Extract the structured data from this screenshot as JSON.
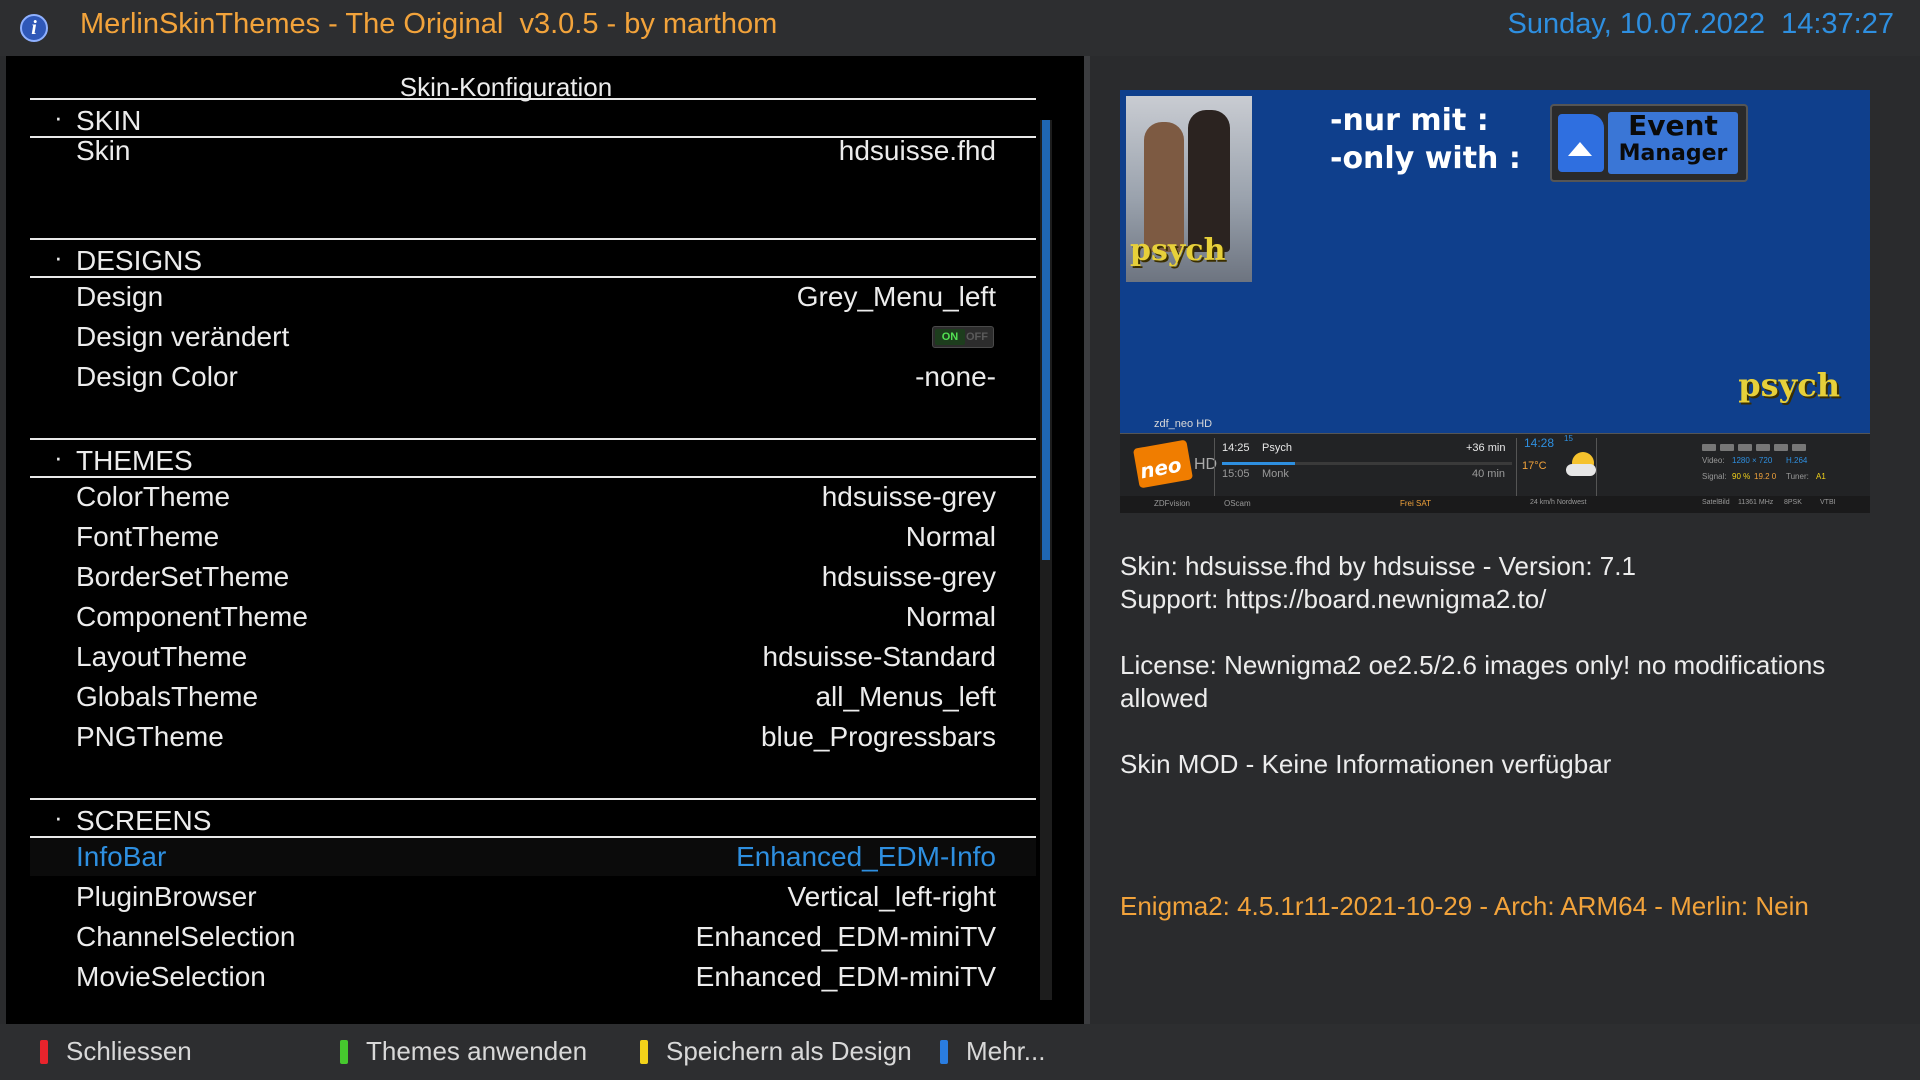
{
  "header": {
    "title": "MerlinSkinThemes - The Original  v3.0.5 - by marthom",
    "datetime": "Sunday, 10.07.2022  14:37:27"
  },
  "left_panel": {
    "title": "Skin-Konfiguration",
    "scroll_fraction_visible": 0.5,
    "sections": [
      {
        "name": "SKIN",
        "rows": [
          {
            "key": "Skin",
            "value": "hdsuisse.fhd"
          }
        ]
      },
      {
        "name": "DESIGNS",
        "rows": [
          {
            "key": "Design",
            "value": "Grey_Menu_left"
          },
          {
            "key": "Design verändert",
            "value": "",
            "toggle": {
              "on_label": "ON",
              "off_label": "OFF",
              "state": true
            }
          },
          {
            "key": "Design Color",
            "value": "-none-"
          }
        ]
      },
      {
        "name": "THEMES",
        "rows": [
          {
            "key": "ColorTheme",
            "value": "hdsuisse-grey"
          },
          {
            "key": "FontTheme",
            "value": "Normal"
          },
          {
            "key": "BorderSetTheme",
            "value": "hdsuisse-grey"
          },
          {
            "key": "ComponentTheme",
            "value": "Normal"
          },
          {
            "key": "LayoutTheme",
            "value": "hdsuisse-Standard"
          },
          {
            "key": "GlobalsTheme",
            "value": "all_Menus_left"
          },
          {
            "key": "PNGTheme",
            "value": "blue_Progressbars"
          }
        ]
      },
      {
        "name": "SCREENS",
        "rows": [
          {
            "key": "InfoBar",
            "value": "Enhanced_EDM-Info",
            "selected": true
          },
          {
            "key": "PluginBrowser",
            "value": "Vertical_left-right"
          },
          {
            "key": "ChannelSelection",
            "value": "Enhanced_EDM-miniTV"
          },
          {
            "key": "MovieSelection",
            "value": "Enhanced_EDM-miniTV"
          }
        ]
      }
    ]
  },
  "preview": {
    "poster_title": "psych",
    "notice": "-nur mit :\n-only with :",
    "badge_line1": "Event",
    "badge_line2": "Manager",
    "watermark": "psych",
    "channel_name": "zdf_neo HD",
    "infobar": {
      "logo_text": "neo",
      "logo_hd": "HD",
      "now_time": "14:25",
      "now_title": "Psych",
      "now_remaining": "+36 min",
      "next_time": "15:05",
      "next_title": "Monk",
      "next_duration": "40 min",
      "clock": "14:28",
      "clock_seconds": "15",
      "temperature": "17°C",
      "progress": 0.25,
      "video_label": "Video:",
      "video_res": "1280 × 720",
      "video_codec": "H.264",
      "signal_label": "Signal:",
      "signal_value": "90 %",
      "signal_db": "19.2 0",
      "tuner_label": "Tuner:",
      "tuner_value": "A1",
      "provider": "ZDFvision",
      "cam": "OScam",
      "free": "Frei SAT",
      "wind": "24 km/h Nordwest",
      "sat": "SatelBild",
      "freq": "11361 MHz",
      "mod": "8PSK",
      "fec": "VTBI"
    }
  },
  "info": {
    "line1": "Skin: hdsuisse.fhd by hdsuisse - Version: 7.1",
    "line2": "Support: https://board.newnigma2.to/",
    "license": "License: Newnigma2 oe2.5/2.6 images only! no modifications allowed",
    "mod": "Skin MOD - Keine Informationen verfügbar",
    "enigma": "Enigma2: 4.5.1r11-2021-10-29 - Arch: ARM64 - Merlin: Nein"
  },
  "footer": {
    "keys": [
      {
        "color": "#e8242c",
        "label": "Schliessen"
      },
      {
        "color": "#46c82e",
        "label": "Themes anwenden"
      },
      {
        "color": "#f2d21a",
        "label": "Speichern als Design"
      },
      {
        "color": "#2a7de0",
        "label": "Mehr..."
      }
    ]
  },
  "colors": {
    "accent_orange": "#f2a33b",
    "accent_blue": "#2e8fe0"
  }
}
